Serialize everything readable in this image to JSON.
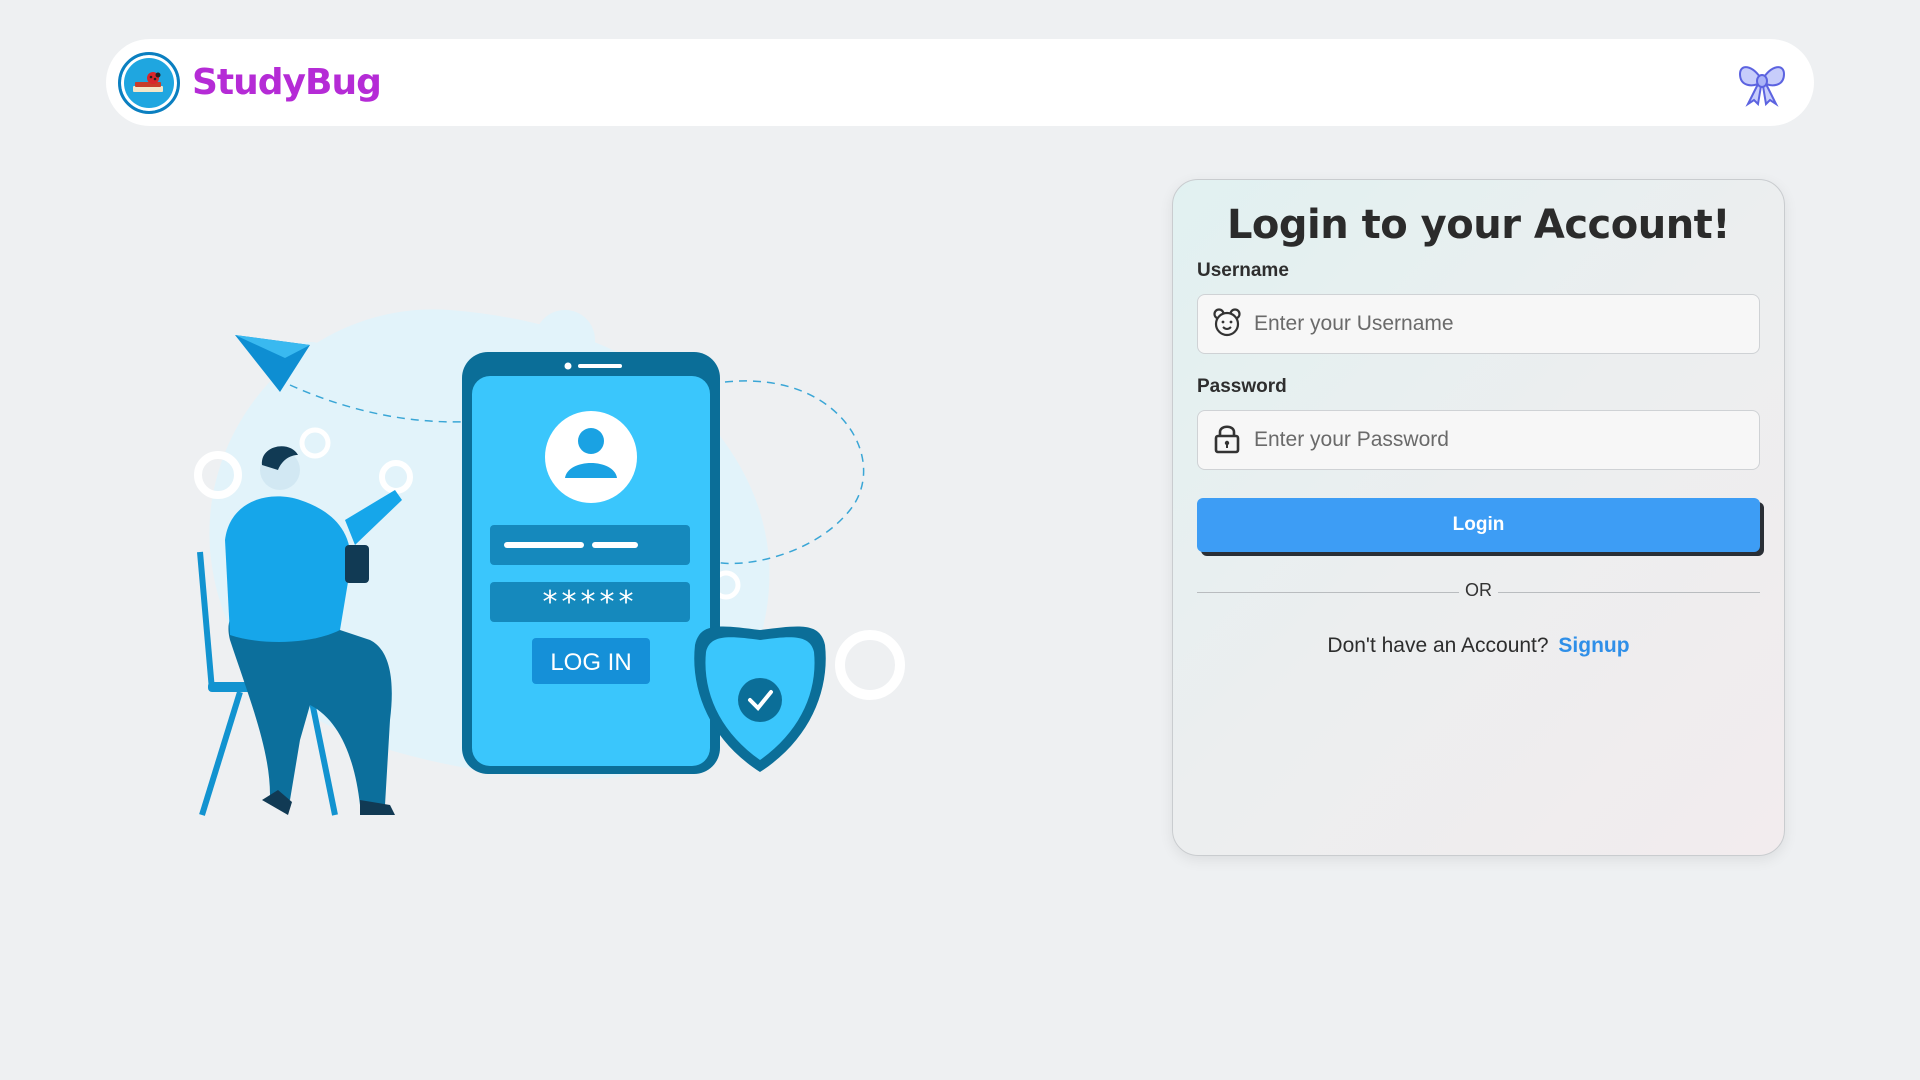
{
  "navbar": {
    "brand_name": "StudyBug",
    "logo_icon": "ladybug-book-logo",
    "right_icon": "bow-ribbon-icon"
  },
  "illustration": {
    "phone_button_label": "LOG IN",
    "password_mask": "*****"
  },
  "login": {
    "title": "Login to your Account!",
    "username_label": "Username",
    "username_placeholder": "Enter your Username",
    "username_icon": "bear-face-icon",
    "password_label": "Password",
    "password_placeholder": "Enter your Password",
    "password_icon": "lock-icon",
    "submit_label": "Login",
    "divider_text": "OR",
    "signup_prompt": "Don't have an Account?",
    "signup_link": "Signup"
  },
  "colors": {
    "brand": "#b52bd6",
    "primary_button": "#3d9df5",
    "link": "#2f8fe8",
    "background": "#eef0f2"
  }
}
